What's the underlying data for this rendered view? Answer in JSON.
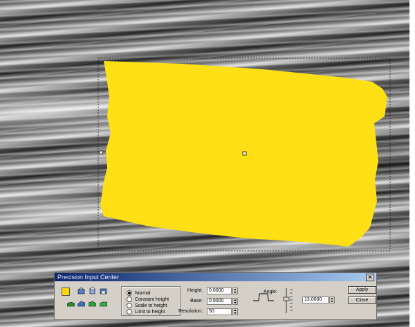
{
  "panel": {
    "title": "Precision Input Center",
    "close_glyph": "✕",
    "fill_color": "#ffd600"
  },
  "tools": [
    "wall-height-icon",
    "cylinder-icon",
    "arch-icon",
    "bridge-icon",
    "terrain-flat-icon",
    "terrain-slope-icon",
    "terrain-green-icon",
    "terrain-green-alt-icon"
  ],
  "modes": {
    "options": [
      "Normal",
      "Constant height",
      "Scale to height",
      "Limit to height"
    ],
    "selected": "Normal"
  },
  "fields": {
    "height_label": "Height:",
    "height_value": "0.0000",
    "base_label": "Base:",
    "base_value": "0.9000",
    "resolution_label": "Resolution:",
    "resolution_value": "50",
    "angle_label": "Angle:",
    "angle_value": "13.0000"
  },
  "buttons": {
    "apply": "Apply",
    "close": "Close"
  },
  "canvas": {
    "shape_color": "#ffe014",
    "texture": "rock-strata-photo"
  }
}
